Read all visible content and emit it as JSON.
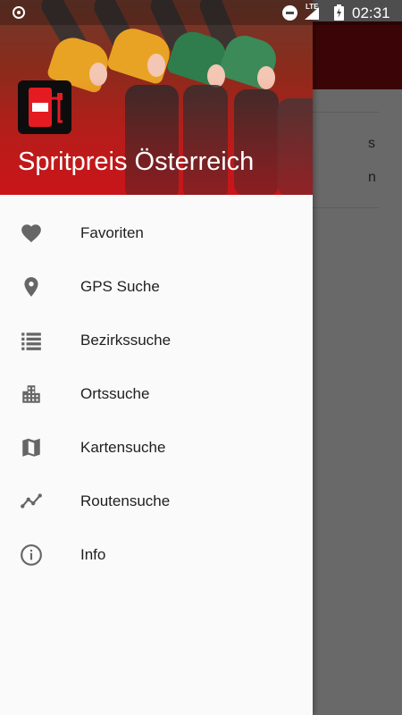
{
  "status_bar": {
    "time": "02:31",
    "network": "LTE"
  },
  "drawer": {
    "title": "Spritpreis Österreich",
    "items": [
      {
        "label": "Favoriten",
        "icon": "heart-icon"
      },
      {
        "label": "GPS Suche",
        "icon": "location-pin-icon"
      },
      {
        "label": "Bezirkssuche",
        "icon": "list-icon"
      },
      {
        "label": "Ortssuche",
        "icon": "city-icon"
      },
      {
        "label": "Kartensuche",
        "icon": "map-icon"
      },
      {
        "label": "Routensuche",
        "icon": "route-icon"
      },
      {
        "label": "Info",
        "icon": "info-icon"
      }
    ]
  },
  "background_app": {
    "fragments": [
      "s",
      "n"
    ]
  },
  "colors": {
    "toolbar": "#8e0d12",
    "drawer_header": "#c8161c",
    "icon_gray": "#666666"
  }
}
